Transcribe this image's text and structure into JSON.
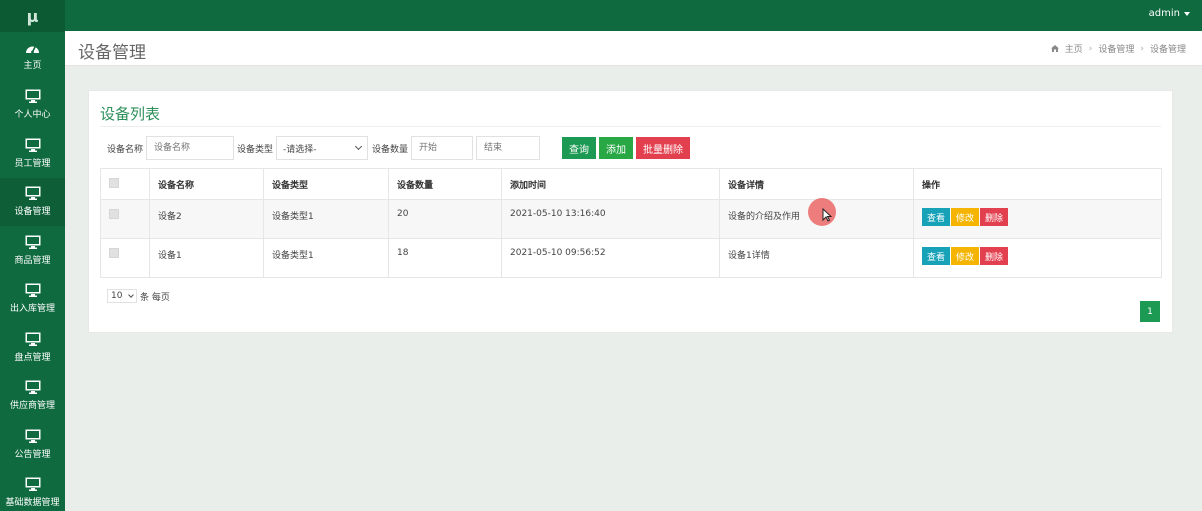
{
  "sidebar": {
    "logo": "μ",
    "items": [
      {
        "label": "主页",
        "icon": "dashboard-icon"
      },
      {
        "label": "个人中心",
        "icon": "monitor-icon"
      },
      {
        "label": "员工管理",
        "icon": "monitor-icon"
      },
      {
        "label": "设备管理",
        "icon": "monitor-icon"
      },
      {
        "label": "商品管理",
        "icon": "monitor-icon"
      },
      {
        "label": "出入库管理",
        "icon": "monitor-icon"
      },
      {
        "label": "盘点管理",
        "icon": "monitor-icon"
      },
      {
        "label": "供应商管理",
        "icon": "monitor-icon"
      },
      {
        "label": "公告管理",
        "icon": "monitor-icon"
      },
      {
        "label": "基础数据管理",
        "icon": "monitor-icon"
      }
    ]
  },
  "topbar": {
    "user": "admin"
  },
  "header": {
    "title": "设备管理",
    "breadcrumb": [
      "主页",
      "设备管理",
      "设备管理"
    ]
  },
  "card": {
    "title": "设备列表"
  },
  "search": {
    "name_label": "设备名称",
    "name_placeholder": "设备名称",
    "type_label": "设备类型",
    "type_selected": "-请选择-",
    "count_label": "设备数量",
    "start_placeholder": "开始",
    "end_placeholder": "结束",
    "query_btn": "查询",
    "add_btn": "添加",
    "batch_delete_btn": "批量删除"
  },
  "table": {
    "columns": [
      "设备名称",
      "设备类型",
      "设备数量",
      "添加时间",
      "设备详情",
      "操作"
    ],
    "rows": [
      {
        "name": "设备2",
        "type": "设备类型1",
        "count": "20",
        "time": "2021-05-10 13:16:40",
        "detail": "设备的介绍及作用"
      },
      {
        "name": "设备1",
        "type": "设备类型1",
        "count": "18",
        "time": "2021-05-10 09:56:52",
        "detail": "设备1详情"
      }
    ],
    "actions": {
      "view": "查看",
      "edit": "修改",
      "delete": "删除"
    }
  },
  "pager": {
    "page_size": "10",
    "page_size_suffix": "条 每页",
    "current_page": "1"
  },
  "colors": {
    "brand": "#0f6a3f",
    "accent_green": "#1c9a54",
    "danger": "#e3404f",
    "warning": "#f4b400",
    "info": "#17a2b8"
  }
}
